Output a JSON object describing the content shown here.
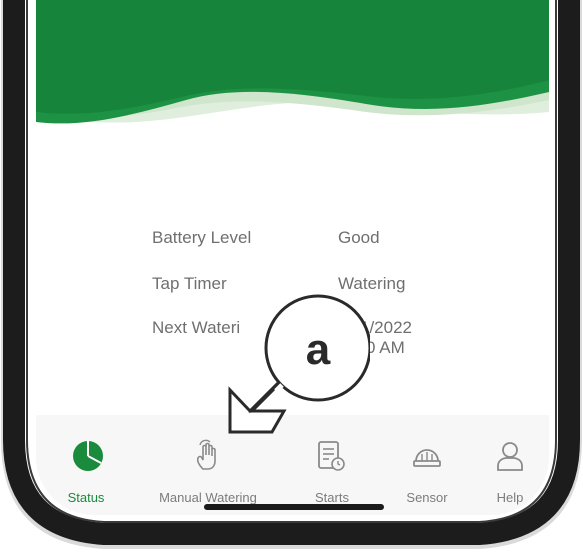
{
  "status_info": {
    "rows": [
      {
        "label": "Battery Level",
        "value": "Good"
      },
      {
        "label": "Tap Timer",
        "value": "Watering"
      },
      {
        "label": "Next Wateri",
        "value": "1/2022",
        "value_line2": "0 AM"
      }
    ]
  },
  "callout": {
    "letter": "a"
  },
  "nav": {
    "items": [
      {
        "label": "Status",
        "icon": "pie-chart-icon",
        "active": true
      },
      {
        "label": "Manual Watering",
        "icon": "hand-tap-icon",
        "active": false
      },
      {
        "label": "Starts",
        "icon": "schedule-doc-icon",
        "active": false
      },
      {
        "label": "Sensor",
        "icon": "sensor-dome-icon",
        "active": false
      },
      {
        "label": "Help",
        "icon": "person-icon",
        "active": false
      }
    ]
  },
  "colors": {
    "brand_green": "#1a8a3c",
    "inactive_gray": "#7c7c7c"
  }
}
